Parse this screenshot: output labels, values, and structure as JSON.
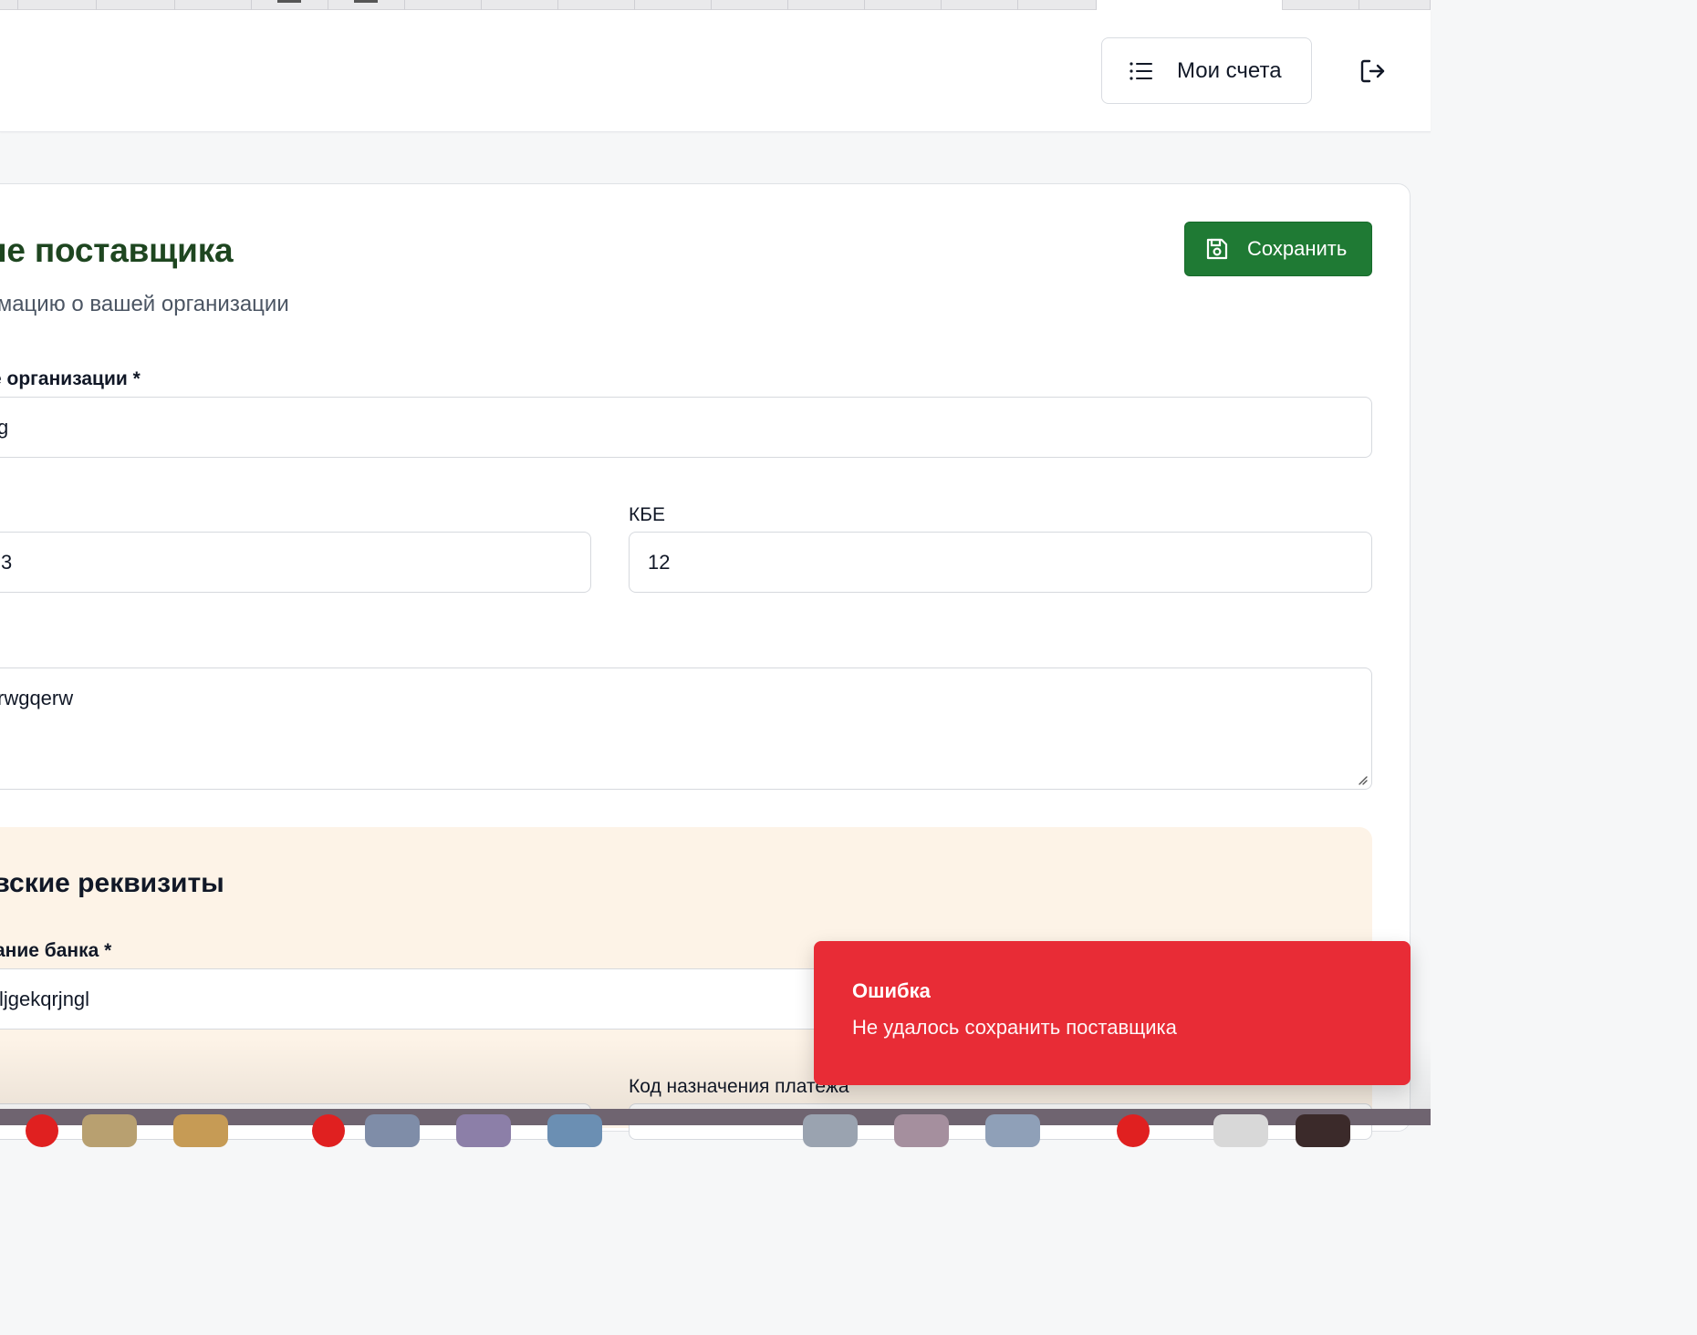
{
  "header": {
    "my_invoices_label": "Мои счета"
  },
  "page": {
    "title": "ые поставщика",
    "subtitle": "ормацию о вашей организации",
    "save_label": "Сохранить"
  },
  "form": {
    "org_name_label": "е организации *",
    "org_name_value": "g",
    "left_field_value": "3",
    "kbe_label": "КБЕ",
    "kbe_value": "12",
    "address_value": "rwgqerw"
  },
  "bank": {
    "title": "овские реквизиты",
    "bank_name_label": "ание банка *",
    "bank_name_value": "ljgekqrjngl",
    "payment_code_label": "Код назначения платежа"
  },
  "toast": {
    "title": "Ошибка",
    "message": "Не удалось сохранить поставщика"
  },
  "colors": {
    "primary_green": "#1f7a34",
    "title_green": "#1e4620",
    "toast_red": "#e82c36",
    "bank_section_bg": "#fdf3e7"
  },
  "icons": {
    "my_invoices": "list-icon",
    "logout": "logout-icon",
    "save": "floppy-disk-icon"
  }
}
